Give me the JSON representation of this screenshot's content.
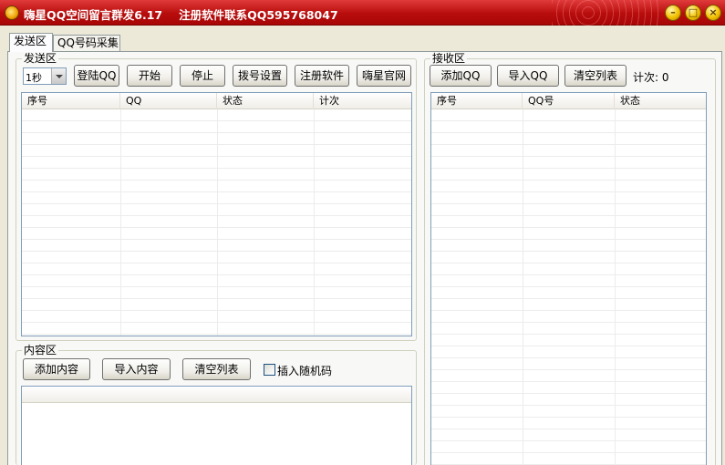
{
  "window": {
    "title": "嗨星QQ空间留言群发6.17",
    "subtitle": "注册软件联系QQ595768047"
  },
  "tabs": [
    "发送区",
    "QQ号码采集"
  ],
  "send": {
    "legend": "发送区",
    "interval": "1秒",
    "buttons": [
      "登陆QQ",
      "开始",
      "停止",
      "拨号设置",
      "注册软件",
      "嗨星官网"
    ],
    "columns": [
      "序号",
      "QQ",
      "状态",
      "计次"
    ]
  },
  "content": {
    "legend": "内容区",
    "buttons": [
      "添加内容",
      "导入内容",
      "清空列表"
    ],
    "checkbox_label": "插入随机码"
  },
  "receive": {
    "legend": "接收区",
    "buttons": [
      "添加QQ",
      "导入QQ",
      "清空列表"
    ],
    "count_label": "计次: 0",
    "columns": [
      "序号",
      "QQ号",
      "状态"
    ]
  }
}
